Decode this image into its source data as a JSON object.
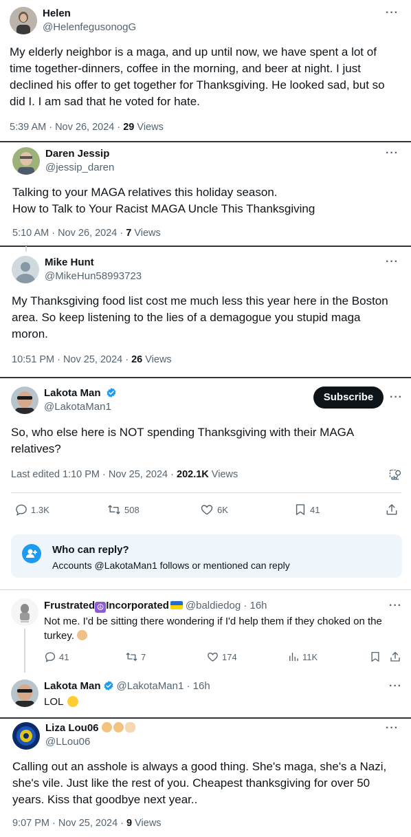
{
  "tweets": {
    "helen": {
      "name": "Helen",
      "handle": "@HelenfegusonogG",
      "body_lines": [
        "My elderly neighbor is a maga, and up until now, we have spent a lot of",
        "time together-dinners, coffee in the morning, and beer at night. I just",
        "declined his offer to get together for Thanksgiving. He looked sad, but so",
        "did I. I am sad that he voted for hate."
      ],
      "time": "5:39 AM · Nov 26, 2024 · ",
      "views_count": "29",
      "views_label": " Views"
    },
    "daren": {
      "name": "Daren Jessip",
      "handle": "@jessip_daren",
      "body_lines": [
        "Talking to your MAGA relatives this holiday season.",
        "How to Talk to Your Racist MAGA Uncle This Thanksgiving"
      ],
      "time": "5:10 AM · Nov 26, 2024 · ",
      "views_count": "7",
      "views_label": " Views"
    },
    "mike": {
      "name": "Mike Hunt",
      "handle": "@MikeHun58993723",
      "body_lines": [
        "My Thanksgiving food list cost me much less this year here in the Boston",
        "area. So keep listening to the lies of a demagogue you stupid maga",
        "moron."
      ],
      "time": "10:51 PM · Nov 25, 2024 · ",
      "views_count": "26",
      "views_label": " Views"
    },
    "lakota": {
      "name": "Lakota Man",
      "handle": "@LakotaMan1",
      "subscribe_label": "Subscribe",
      "body_lines": [
        "So, who else here is NOT spending Thanksgiving with their MAGA",
        "relatives?"
      ],
      "time": "Last edited 1:10 PM · Nov 25, 2024 · ",
      "views_count": "202.1K",
      "views_label": " Views",
      "actions": {
        "replies": "1.3K",
        "reposts": "508",
        "likes": "6K",
        "bookmarks": "41"
      },
      "who_can_reply": {
        "title": "Who can reply?",
        "text": "Accounts @LakotaMan1 follows or mentioned can reply"
      }
    },
    "frustrated": {
      "name_part1": "Frustrated",
      "name_part2": "Incorporated",
      "handle_time": "@baldiedog · 16h",
      "body_lines": [
        "Not me. I'd be sitting there wondering if I'd help them if they choked on the",
        "turkey."
      ],
      "actions": {
        "replies": "41",
        "reposts": "7",
        "likes": "174",
        "views": "11K"
      }
    },
    "lakota_reply": {
      "name": "Lakota Man",
      "handle_time": "@LakotaMan1 · 16h",
      "body": "LOL"
    },
    "liza": {
      "name": "Liza Lou06",
      "handle": "@LLou06",
      "body_lines": [
        "Calling out an asshole is always a good thing. She's maga, she's a Nazi,",
        "she's vile. Just like the rest of you. Cheapest thanksgiving for over 50",
        "years. Kiss that goodbye next year.."
      ],
      "time": "9:07 PM · Nov 25, 2024 · ",
      "views_count": "9",
      "views_label": " Views"
    }
  },
  "more_glyph": "···",
  "colors": {
    "text": "#0f1419",
    "secondary": "#536471",
    "verified": "#1d9bf0",
    "divider": "#cfd9de",
    "notice_bg": "#f7f9f9"
  }
}
